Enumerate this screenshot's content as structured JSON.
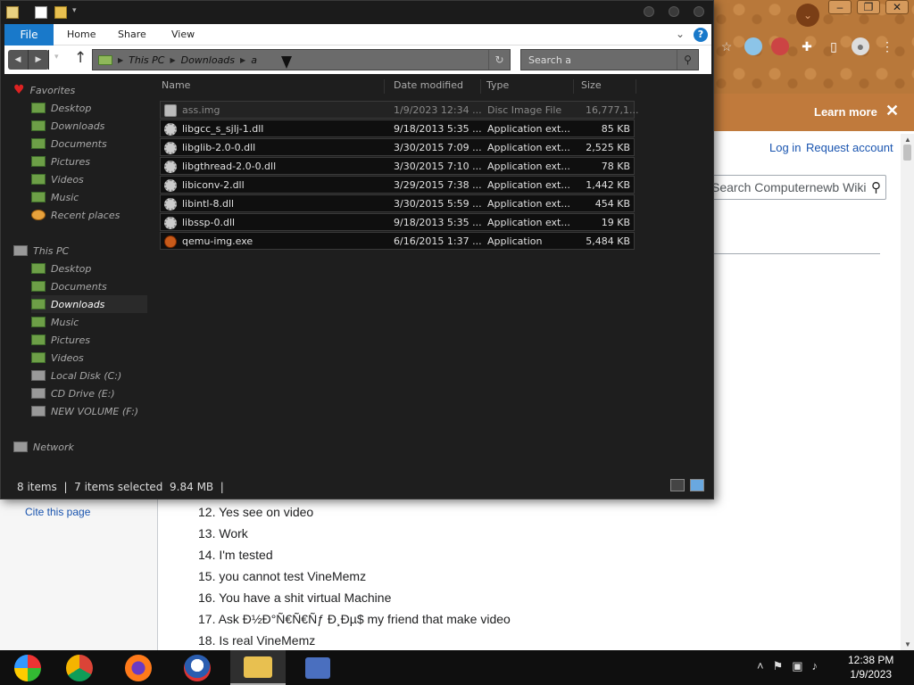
{
  "browser": {
    "banner_learn_more": "Learn more",
    "banner_close": "✕",
    "login_link": "Log in",
    "request_account_link": "Request account",
    "search_placeholder": "Search Computernewb Wiki",
    "cite_link": "Cite this page",
    "list_items": [
      "12. Yes see on video",
      "13. Work",
      "14. I'm tested",
      "15. you cannot test VineMemz",
      "16. You have a shit virtual Machine",
      "17. Ask Ð½Ð°Ñ€Ñ€Ñƒ Ð¸Ðµ$ my friend that make video",
      "18. Is real VineMemz"
    ]
  },
  "explorer": {
    "ribbon": {
      "file": "File",
      "home": "Home",
      "share": "Share",
      "view": "View"
    },
    "breadcrumb": [
      "This PC",
      "Downloads",
      "a"
    ],
    "search_placeholder": "Search a",
    "nav": {
      "favorites": "Favorites",
      "fav_items": [
        "Desktop",
        "Downloads",
        "Documents",
        "Pictures",
        "Videos",
        "Music",
        "Recent places"
      ],
      "this_pc": "This PC",
      "pc_items": [
        "Desktop",
        "Documents",
        "Downloads",
        "Music",
        "Pictures",
        "Videos",
        "Local Disk (C:)",
        "CD Drive (E:)",
        "NEW VOLUME (F:)"
      ],
      "network": "Network"
    },
    "columns": {
      "name": "Name",
      "date": "Date modified",
      "type": "Type",
      "size": "Size"
    },
    "files": [
      {
        "name": "ass.img",
        "date": "1/9/2023 12:34 ...",
        "type": "Disc Image File",
        "size": "16,777,1..."
      },
      {
        "name": "libgcc_s_sjlj-1.dll",
        "date": "9/18/2013 5:35 ...",
        "type": "Application ext...",
        "size": "85 KB"
      },
      {
        "name": "libglib-2.0-0.dll",
        "date": "3/30/2015 7:09 ...",
        "type": "Application ext...",
        "size": "2,525 KB"
      },
      {
        "name": "libgthread-2.0-0.dll",
        "date": "3/30/2015 7:10 ...",
        "type": "Application ext...",
        "size": "78 KB"
      },
      {
        "name": "libiconv-2.dll",
        "date": "3/29/2015 7:38 ...",
        "type": "Application ext...",
        "size": "1,442 KB"
      },
      {
        "name": "libintl-8.dll",
        "date": "3/30/2015 5:59 ...",
        "type": "Application ext...",
        "size": "454 KB"
      },
      {
        "name": "libssp-0.dll",
        "date": "9/18/2013 5:35 ...",
        "type": "Application ext...",
        "size": "19 KB"
      },
      {
        "name": "qemu-img.exe",
        "date": "6/16/2015 1:37 ...",
        "type": "Application",
        "size": "5,484 KB"
      }
    ],
    "status": {
      "items": "8 items",
      "selected": "7 items selected",
      "size": "9.84 MB"
    }
  },
  "taskbar": {
    "time": "12:38 PM",
    "date": "1/9/2023",
    "apps": [
      "windows-logo",
      "chrome",
      "firefox",
      "obama-campaign",
      "file-explorer",
      "my-computer"
    ]
  }
}
